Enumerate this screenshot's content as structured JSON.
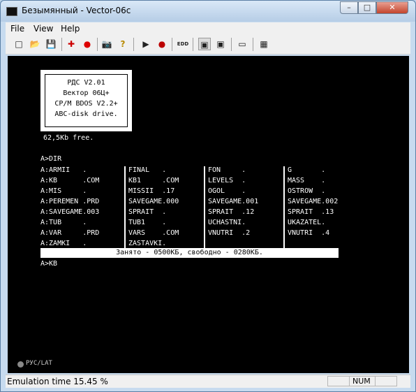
{
  "window": {
    "title": "Безымянный - Vector-06c",
    "min": "–",
    "max": "□",
    "close": "✕"
  },
  "menu": [
    "File",
    "View",
    "Help"
  ],
  "toolbar": {
    "new_icon": "□",
    "open_icon": "📂",
    "save_icon": "💾",
    "cross_icon": "✚",
    "record_icon": "●",
    "camera_icon": "📷",
    "help_icon": "?",
    "run_icon": "▶",
    "stop_icon": "●",
    "edd_icon": "EDD",
    "disk_a_icon": "▣",
    "disk_b_icon": "▣",
    "tape_icon": "▭",
    "chip_icon": "▦"
  },
  "screen": {
    "banner": [
      "РДС V2.01",
      "Вектор 06Ц+",
      "CP/M BDOS V2.2+",
      "ABC-disk drive."
    ],
    "free": "62,5Kb free.",
    "prompt1": "A>DIR",
    "columns": [
      [
        "A:ARMII   .",
        "A:KB      .COM",
        "A:MIS     .",
        "A:PEREMEN .PRD",
        "A:SAVEGAME.003",
        "A:TUB     .",
        "A:VAR     .PRD",
        "A:ZAMKI   ."
      ],
      [
        "FINAL   .",
        "KB1     .COM",
        "MISSII  .17",
        "SAVEGAME.000",
        "SPRAIT  .",
        "TUB1    .",
        "VARS    .COM",
        "ZASTAVKI."
      ],
      [
        "FON     .",
        "LEVELS  .",
        "OGOL    .",
        "SAVEGAME.001",
        "SPRAIT  .12",
        "UCHASTNI.",
        "VNUTRI  .2"
      ],
      [
        "G       .",
        "MASS    .",
        "OSTROW  .",
        "SAVEGAME.002",
        "SPRAIT  .13",
        "UKAZATEL.",
        "VNUTRI  .4"
      ]
    ],
    "status": "Занято - 0500КБ, свободно - 0280КБ.",
    "prompt2": "A>KB",
    "rus_lat": "РУС/LAT"
  },
  "statusbar": {
    "text": "Emulation time 15.45 %",
    "num": "NUM"
  }
}
